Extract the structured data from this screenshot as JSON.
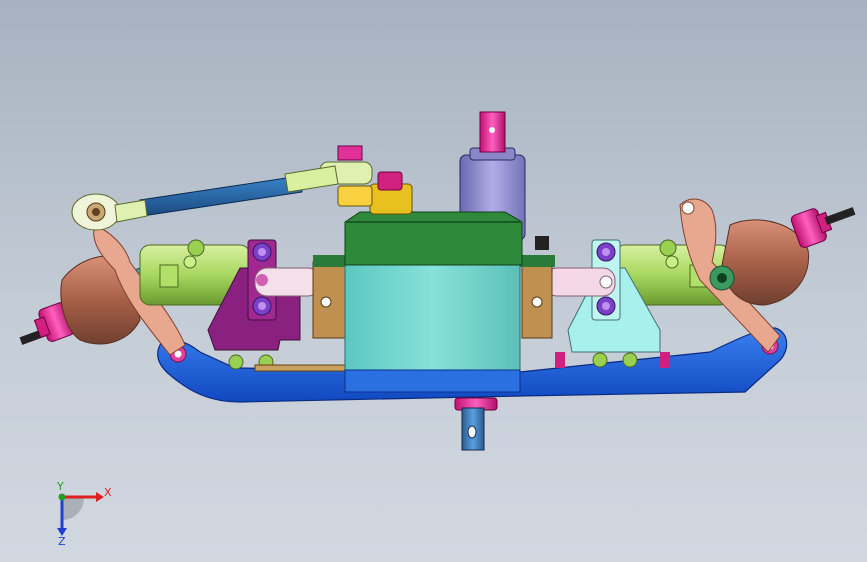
{
  "viewport": {
    "background_top": "#a6b2c0",
    "background_bottom": "#d2d8e0"
  },
  "triad": {
    "x_label": "X",
    "y_label": "Y",
    "z_label": "Z",
    "x_color": "#e02020",
    "y_color": "#20a020",
    "z_color": "#2040d0"
  },
  "model": {
    "main_box_color": "#7ad8d0",
    "top_cover_color": "#2e8a3a",
    "lower_arm_color": "#1a5ee0",
    "knuckle_color": "#b06a50",
    "hub_color": "#e0309a",
    "axle_tube_color": "#b8e070",
    "tie_rod_color": "#2a6aa8",
    "motor_color": "#9a98d8",
    "bracket_left_color": "#8a2080",
    "bracket_right_color": "#a8f0ec"
  }
}
